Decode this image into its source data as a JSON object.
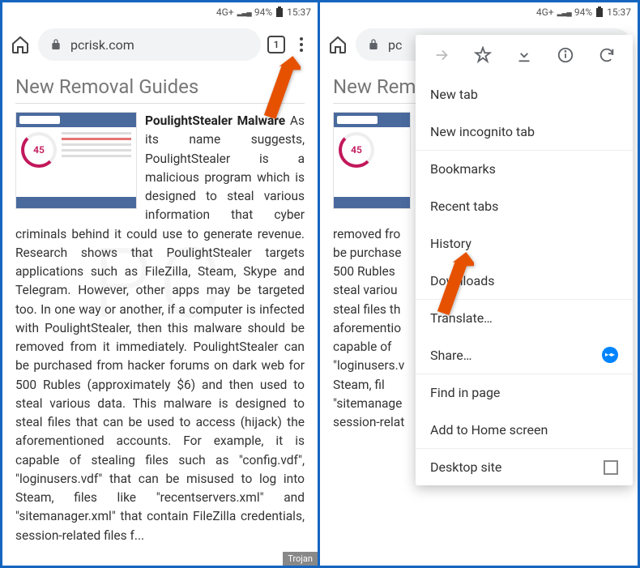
{
  "status": {
    "network": "4G+",
    "signal": "▂▃▄",
    "battery": "94%",
    "time": "15:37"
  },
  "toolbar": {
    "url": "pcrisk.com",
    "url_partial": "pc",
    "tab_count": "1"
  },
  "page": {
    "heading": "New Removal Guides",
    "heading_partial": "New Rem",
    "article_title": "PoulightStealer Malware",
    "article_body": "As its name suggests, PoulightStealer is a malicious program which is designed to steal various information that cyber criminals behind it could use to generate revenue. Research shows that PoulightStealer targets applications such as FileZilla, Steam, Skype and Telegram. However, other apps may be targeted too. In one way or another, if a computer is infected with PoulightStealer, then this malware should be removed from it immediately. PoulightStealer can be purchased from hacker forums on dark web for 500 Rubles (approximately $6) and then used to steal various data. This malware is designed to steal files that can be used to access (hijack) the aforementioned accounts. For example, it is capable of stealing files such as \"config.vdf\", \"loginusers.vdf\" that can be misused to log into Steam, files like \"recentservers.xml\" and \"sitemanager.xml\" that contain FileZilla credentials, session-related files f...",
    "gauge_value": "45",
    "tag": "Trojan"
  },
  "article_lines_right": [
    "criminals be",
    "Research s",
    "applications",
    "Telegram. H",
    "too. In one w",
    "with Poulig",
    "removed fro",
    "be purchase",
    "500 Rubles",
    "steal variou",
    "steal files th",
    "aforementio",
    "capable of",
    "\"loginusers.v",
    "Steam, fil",
    "\"sitemanage",
    "session-relat"
  ],
  "menu": {
    "items": [
      "New tab",
      "New incognito tab",
      "Bookmarks",
      "Recent tabs",
      "History",
      "Downloads",
      "Translate…",
      "Share…",
      "Find in page",
      "Add to Home screen",
      "Desktop site"
    ]
  }
}
